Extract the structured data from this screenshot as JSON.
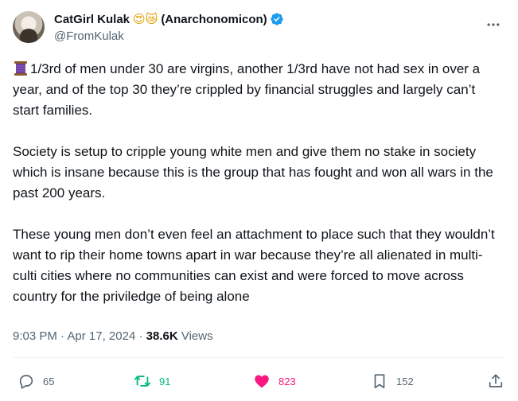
{
  "author": {
    "display_name": "CatGirl Kulak",
    "emojis": "😍😿",
    "display_name_suffix": "(Anarchonomicon)",
    "handle": "@FromKulak",
    "verified": true
  },
  "icons": {
    "more": "more-dots-icon",
    "verified": "verified-badge-icon",
    "spool": "spool-of-thread-icon",
    "reply": "reply-icon",
    "retweet": "retweet-icon",
    "like": "heart-icon",
    "bookmark": "bookmark-icon",
    "share": "share-icon"
  },
  "post": {
    "paragraphs": [
      "1/3rd of men under 30 are virgins, another 1/3rd have not had sex in over a year, and of the top 30 they’re crippled by financial struggles and largely can’t start families.",
      "Society is setup to cripple young white men and give them no stake in society which is insane because this is the group that has fought and won all wars in the past 200 years.",
      "These young men don’t even feel an attachment to place such that they wouldn’t want to rip their home towns apart in war because they’re all alienated in multi-culti cities where no communities can exist  and  were forced to move across country for the priviledge of being alone"
    ]
  },
  "meta": {
    "time": "9:03 PM",
    "separator": " · ",
    "date": "Apr 17, 2024",
    "views_count": "38.6K",
    "views_label": "Views"
  },
  "actions": {
    "replies": "65",
    "retweets": "91",
    "likes": "823",
    "bookmarks": "152"
  },
  "colors": {
    "text": "#0f1419",
    "secondary": "#536471",
    "verified": "#1d9bf0",
    "retweet": "#00ba7c",
    "like": "#f91880",
    "divider": "#eff3f4"
  }
}
